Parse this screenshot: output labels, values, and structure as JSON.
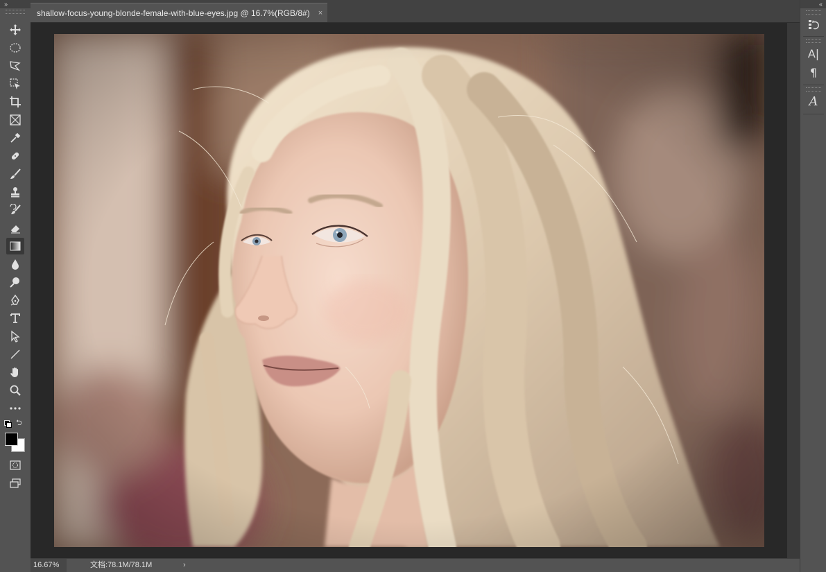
{
  "document": {
    "tab_title": "shallow-focus-young-blonde-female-with-blue-eyes.jpg @ 16.7%(RGB/8#)",
    "close_glyph": "×"
  },
  "toolbar": {
    "collapse_glyph": "»",
    "tools": [
      {
        "name": "move-tool",
        "icon": "move-icon"
      },
      {
        "name": "marquee-tool",
        "icon": "ellipse-marquee-icon"
      },
      {
        "name": "lasso-tool",
        "icon": "polygonal-lasso-icon"
      },
      {
        "name": "object-select-tool",
        "icon": "object-selection-icon"
      },
      {
        "name": "crop-tool",
        "icon": "crop-icon"
      },
      {
        "name": "frame-tool",
        "icon": "frame-icon"
      },
      {
        "name": "eyedropper-tool",
        "icon": "eyedropper-icon"
      },
      {
        "name": "healing-brush-tool",
        "icon": "bandage-icon"
      },
      {
        "name": "brush-tool",
        "icon": "brush-icon"
      },
      {
        "name": "stamp-tool",
        "icon": "clone-stamp-icon"
      },
      {
        "name": "history-brush-tool",
        "icon": "history-brush-icon"
      },
      {
        "name": "eraser-tool",
        "icon": "eraser-icon"
      },
      {
        "name": "gradient-tool",
        "icon": "gradient-icon"
      },
      {
        "name": "blur-tool",
        "icon": "blur-drop-icon"
      },
      {
        "name": "dodge-tool",
        "icon": "dodge-icon"
      },
      {
        "name": "pen-tool",
        "icon": "pen-icon"
      },
      {
        "name": "type-tool",
        "icon": "type-icon"
      },
      {
        "name": "path-select-tool",
        "icon": "path-selection-icon"
      },
      {
        "name": "line-tool",
        "icon": "line-icon"
      },
      {
        "name": "hand-tool",
        "icon": "hand-icon"
      },
      {
        "name": "zoom-tool",
        "icon": "zoom-icon"
      },
      {
        "name": "more-tools",
        "icon": "more-icon"
      }
    ],
    "foreground_color": "#000000",
    "background_color": "#ffffff"
  },
  "right_dock": {
    "collapse_glyph": "«",
    "buttons": [
      {
        "name": "history-panel-button",
        "icon": "history-icon"
      },
      {
        "name": "character-panel-button",
        "icon": "character-icon",
        "label": "A|"
      },
      {
        "name": "paragraph-panel-button",
        "icon": "paragraph-icon",
        "label": "¶"
      },
      {
        "name": "glyphs-panel-button",
        "icon": "glyphs-icon",
        "label": "A"
      }
    ]
  },
  "status": {
    "zoom": "16.67%",
    "doc_info": "文档:78.1M/78.1M",
    "menu_arrow": "›"
  },
  "colors": {
    "panel": "#535353",
    "canvas_bg": "#282828",
    "tab_bar": "#424242"
  }
}
